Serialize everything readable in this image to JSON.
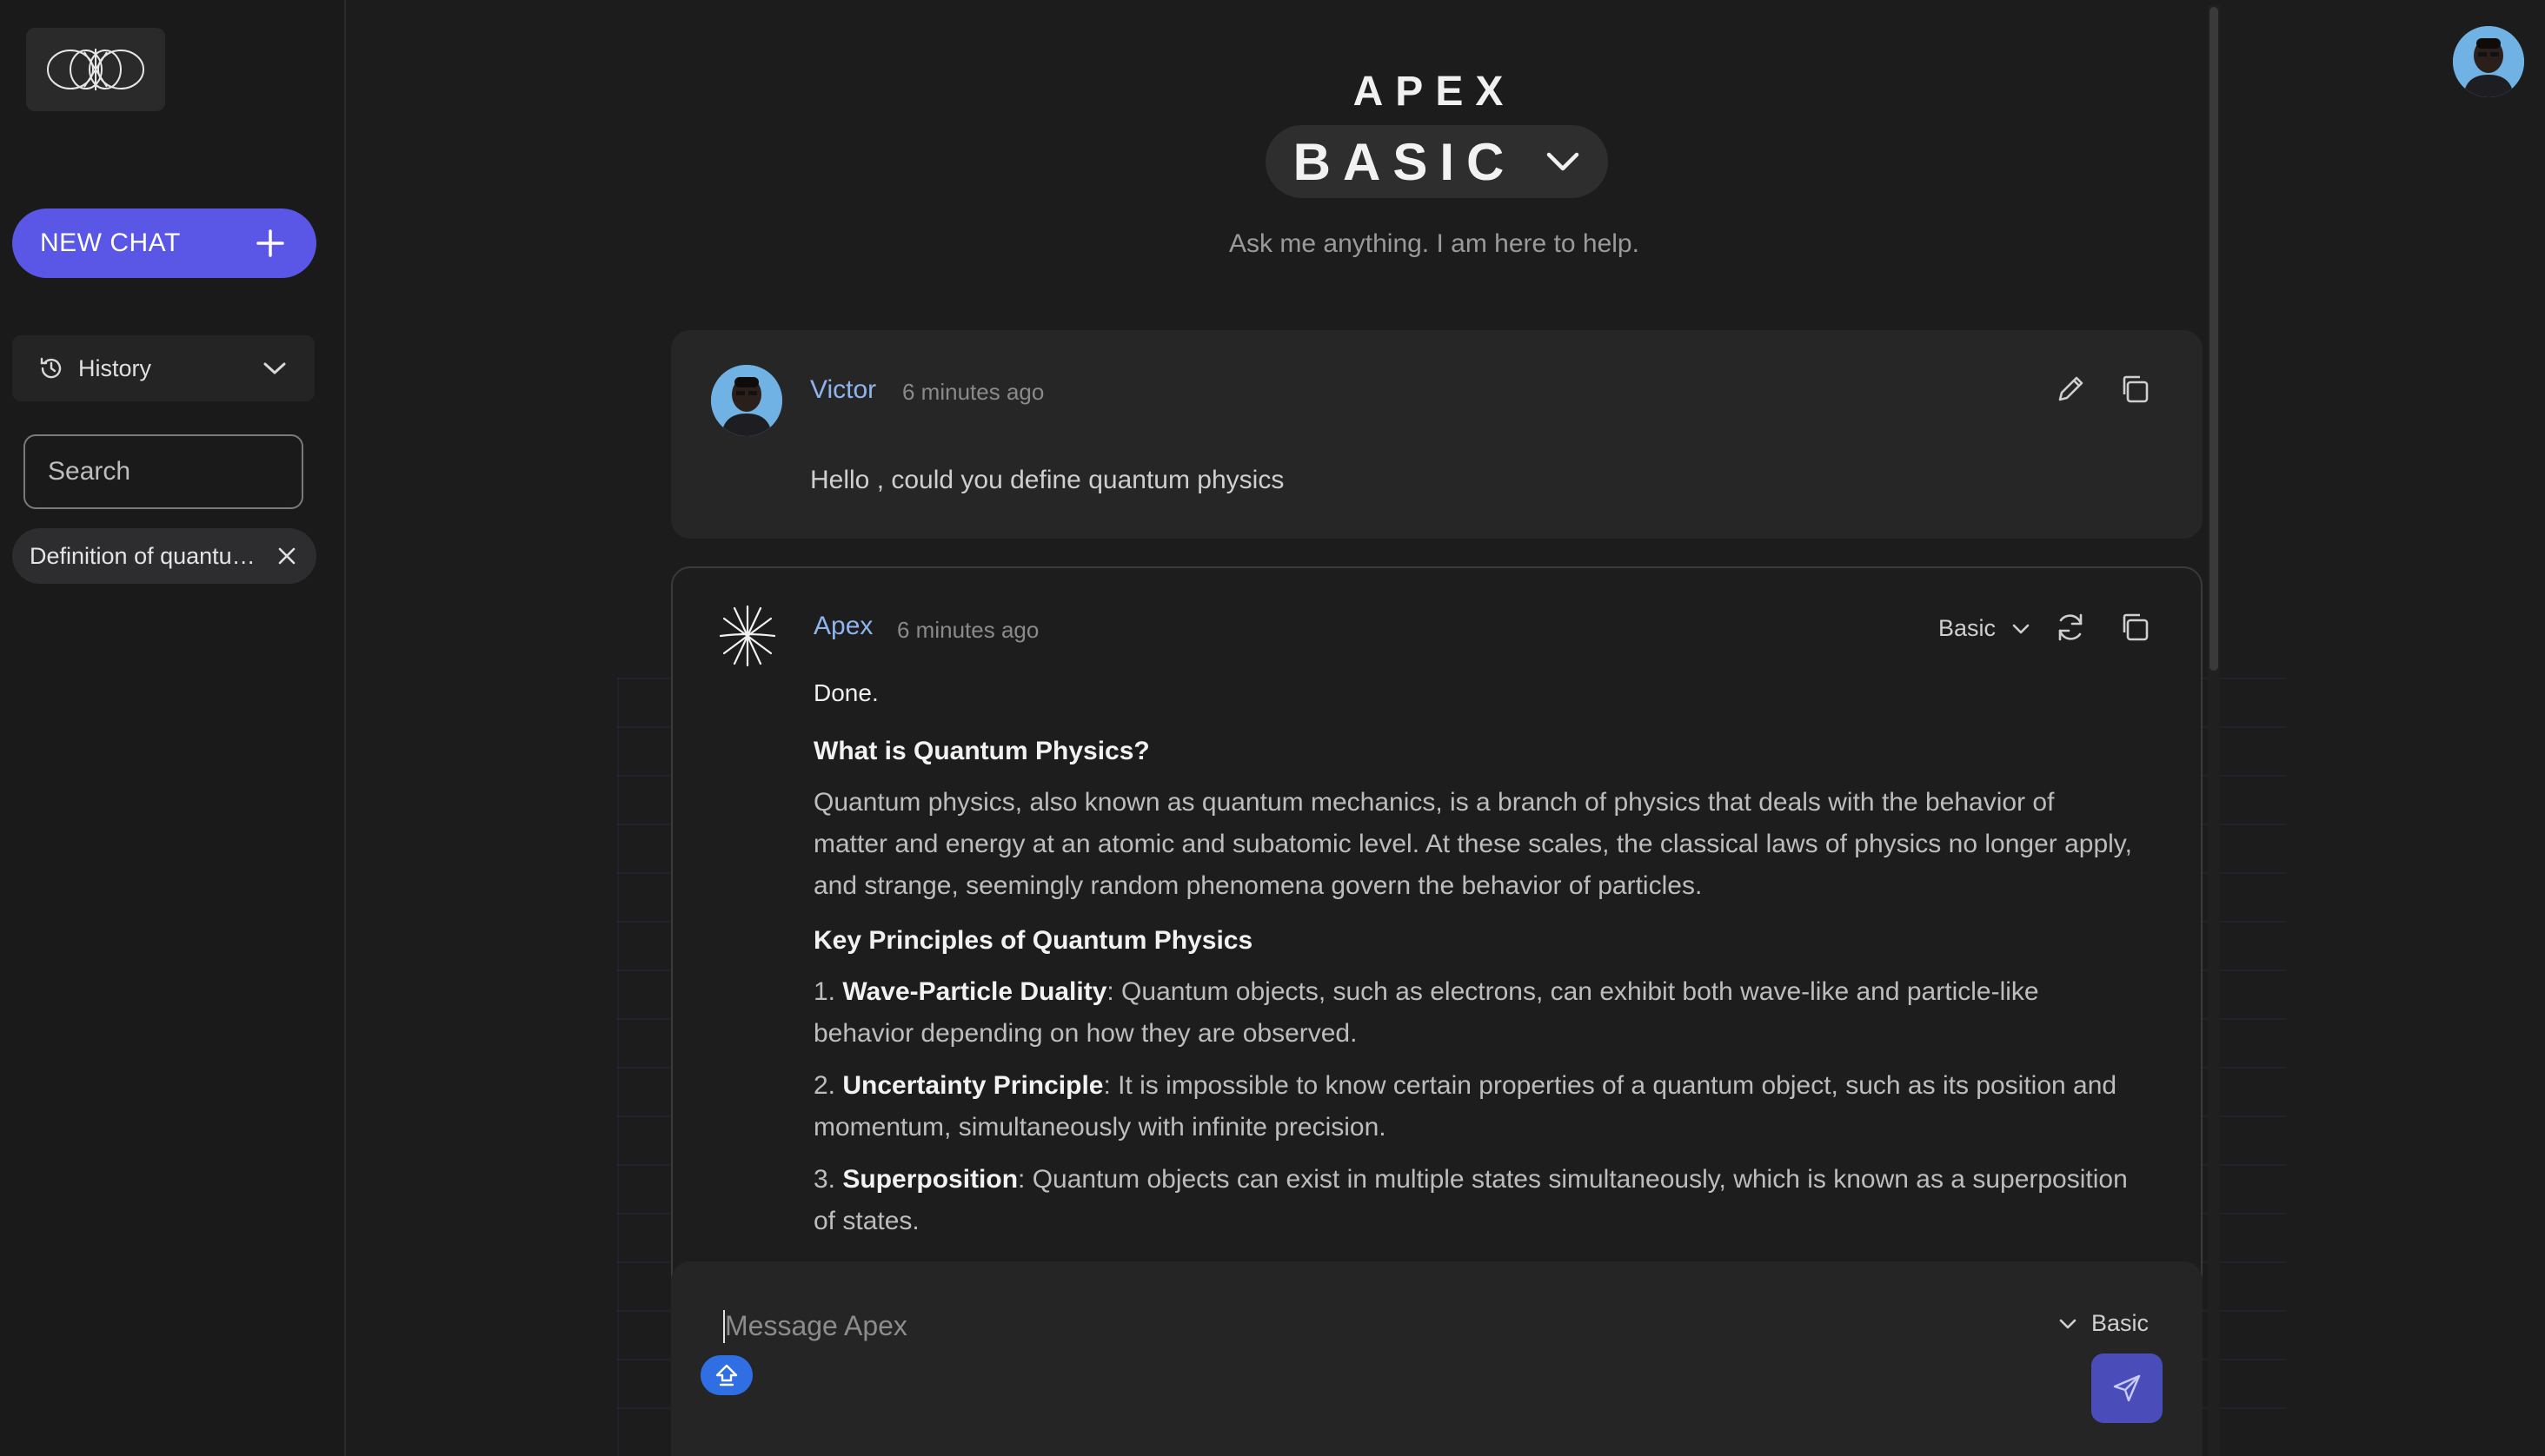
{
  "sidebar": {
    "new_chat_label": "NEW CHAT",
    "history_label": "History",
    "search_placeholder": "Search",
    "conversations": [
      "Definition of quantum physics"
    ]
  },
  "header": {
    "brand": "APEX",
    "mode": "BASIC",
    "subtitle": "Ask me anything. I am here to help."
  },
  "messages": {
    "user": {
      "name": "Victor",
      "time": "6 minutes ago",
      "text": "Hello , could you define quantum physics"
    },
    "assistant": {
      "name": "Apex",
      "time": "6 minutes ago",
      "model": "Basic",
      "intro": "Done.",
      "heading1": "What is Quantum Physics?",
      "para1": "Quantum physics, also known as quantum mechanics, is a branch of physics that deals with the behavior of matter and energy at an atomic and subatomic level. At these scales, the classical laws of physics no longer apply, and strange, seemingly random phenomena govern the behavior of particles.",
      "heading2": "Key Principles of Quantum Physics",
      "items": [
        {
          "num": "1.",
          "title": "Wave-Particle Duality",
          "text": ": Quantum objects, such as electrons, can exhibit both wave-like and particle-like behavior depending on how they are observed."
        },
        {
          "num": "2.",
          "title": "Uncertainty Principle",
          "text": ": It is impossible to know certain properties of a quantum object, such as its position and momentum, simultaneously with infinite precision."
        },
        {
          "num": "3.",
          "title": "Superposition",
          "text": ": Quantum objects can exist in multiple states simultaneously, which is known as a superposition of states."
        }
      ]
    }
  },
  "composer": {
    "placeholder": "Message Apex",
    "model": "Basic"
  },
  "colors": {
    "accent": "#5a57e6",
    "name_link": "#8fb4ee",
    "background": "#1c1c1c"
  }
}
